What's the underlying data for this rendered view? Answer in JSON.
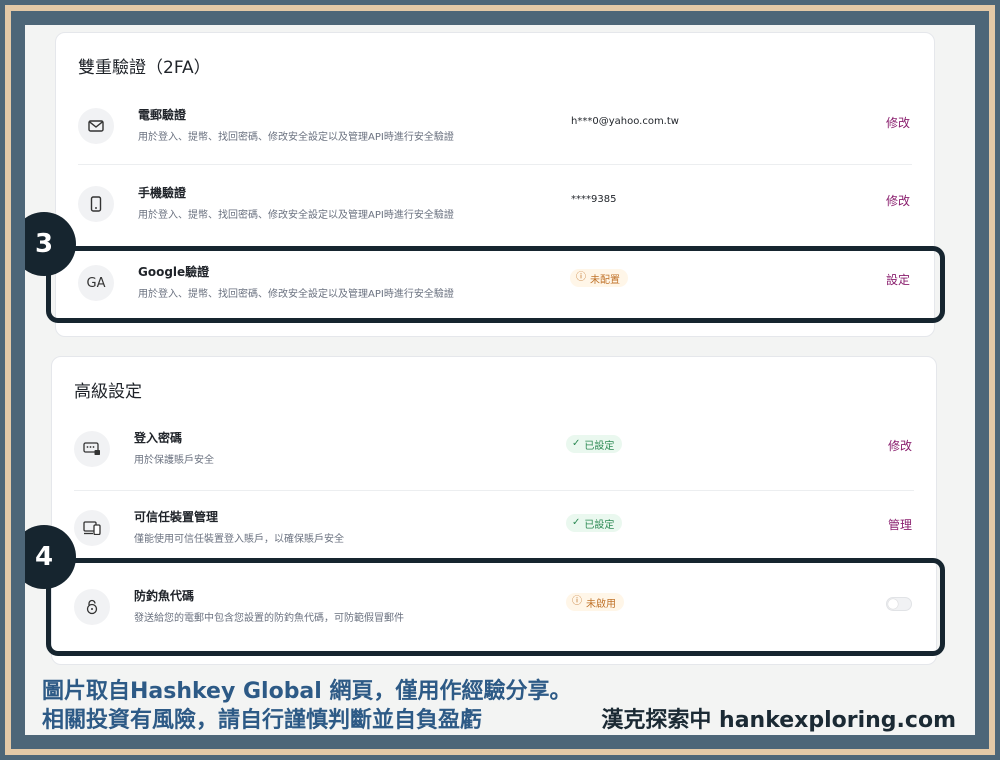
{
  "two_factor": {
    "title": "雙重驗證（2FA）",
    "rows": [
      {
        "icon": "envelope-icon",
        "title": "電郵驗證",
        "desc": "用於登入、提幣、找回密碼、修改安全設定以及管理API時進行安全驗證",
        "value": "h***0@yahoo.com.tw",
        "action": "修改"
      },
      {
        "icon": "phone-icon",
        "title": "手機驗證",
        "desc": "用於登入、提幣、找回密碼、修改安全設定以及管理API時進行安全驗證",
        "value": "****9385",
        "action": "修改"
      },
      {
        "icon_text": "GA",
        "title": "Google驗證",
        "desc": "用於登入、提幣、找回密碼、修改安全設定以及管理API時進行安全驗證",
        "status": "未配置",
        "action": "設定"
      }
    ]
  },
  "advanced": {
    "title": "高級設定",
    "rows": [
      {
        "icon": "password-keyboard-icon",
        "title": "登入密碼",
        "desc": "用於保護賬戶安全",
        "status": "已設定",
        "action": "修改"
      },
      {
        "icon": "devices-icon",
        "title": "可信任裝置管理",
        "desc": "僅能使用可信任裝置登入賬戶，以確保賬戶安全",
        "status": "已設定",
        "action": "管理"
      },
      {
        "icon": "lock-icon",
        "title": "防釣魚代碼",
        "desc": "發送給您的電郵中包含您設置的防釣魚代碼，可防範假冒郵件",
        "status": "未啟用",
        "toggle": false
      }
    ]
  },
  "annotations": {
    "step3": "3",
    "step4": "4"
  },
  "caption": {
    "line1": "圖片取自Hashkey  Global  網頁，僅用作經驗分享。",
    "line2": "相關投資有風險，請自行謹慎判斷並自負盈虧",
    "credit": "漢克探索中 hankexploring.com"
  },
  "colors": {
    "action": "#8a1f6e",
    "warn_badge": "#c0732a",
    "ok_badge": "#2d8a54",
    "highlight": "#16252f",
    "caption": "#2d5a86"
  }
}
